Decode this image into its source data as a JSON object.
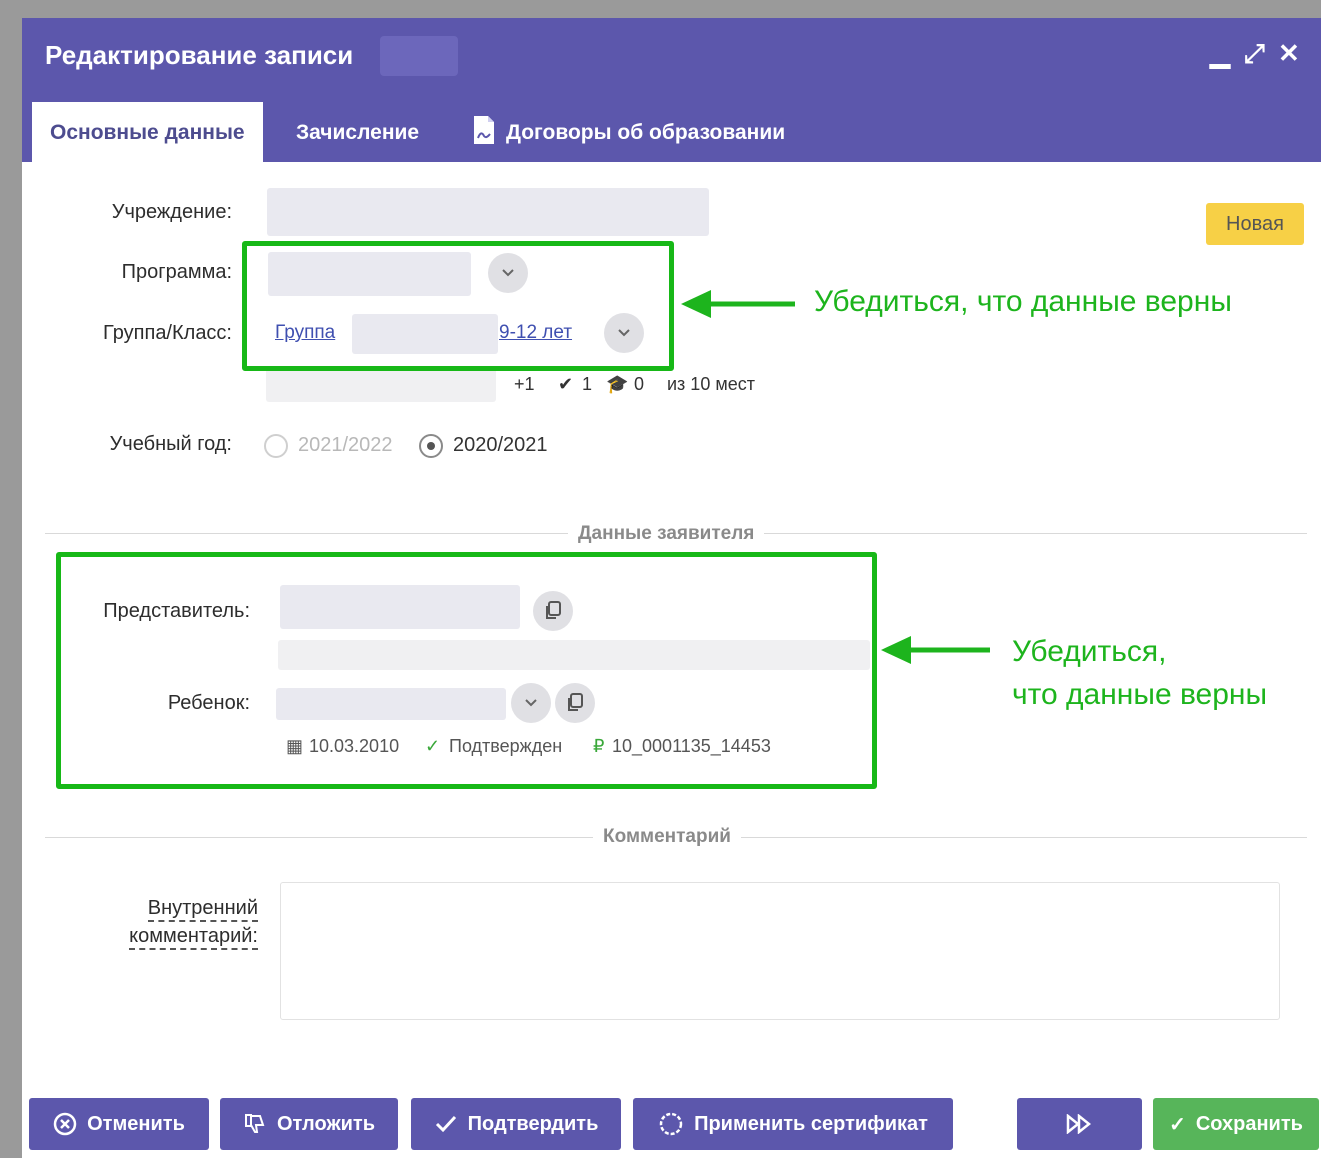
{
  "dialog": {
    "title": "Редактирование записи",
    "controls": {
      "minimize": "▁",
      "maximize": "⤢",
      "close": "✕"
    }
  },
  "tabs": [
    {
      "label": "Основные данные",
      "active": true
    },
    {
      "label": "Зачисление",
      "active": false
    },
    {
      "label": "Договоры об образовании",
      "active": false,
      "icon": "document-icon"
    }
  ],
  "form": {
    "institution_label": "Учреждение:",
    "program_label": "Программа:",
    "group_label": "Группа/Класс:",
    "group_link_prefix": "Группа ",
    "group_link_suffix": "9-12 лет",
    "stats": {
      "plus": "+1",
      "check": "1",
      "grad": "0",
      "places": "из 10 мест"
    },
    "status_badge": "Новая",
    "year_label": "Учебный год:",
    "years": [
      {
        "label": "2021/2022",
        "selected": false
      },
      {
        "label": "2020/2021",
        "selected": true
      }
    ]
  },
  "applicant_section": {
    "title": "Данные заявителя",
    "representative_label": "Представитель:",
    "child_label": "Ребенок:",
    "child_birthdate": "10.03.2010",
    "child_status": "Подтвержден",
    "child_certificate": "10_0001135_14453"
  },
  "comment_section": {
    "title": "Комментарий",
    "internal_label_line1": "Внутренний",
    "internal_label_line2": "комментарий:"
  },
  "annotations": {
    "note1": "Убедиться, что данные верны",
    "note2_line1": "Убедиться,",
    "note2_line2": "что данные верны",
    "color": "#1db41d"
  },
  "footer": {
    "cancel": "Отменить",
    "postpone": "Отложить",
    "confirm": "Подтвердить",
    "certificate": "Применить сертификат",
    "save": "Сохранить"
  },
  "colors": {
    "header": "#5c57ac",
    "badge": "#f7d046",
    "save": "#57b55a"
  }
}
